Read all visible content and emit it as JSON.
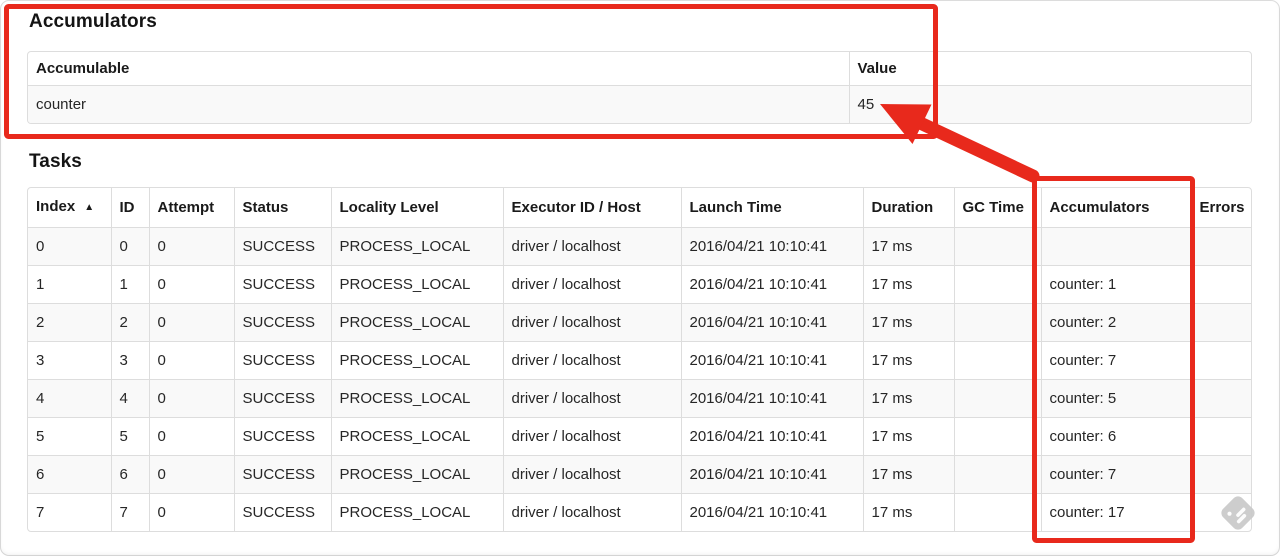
{
  "accumulators": {
    "title": "Accumulators",
    "table": {
      "headers": [
        "Accumulable",
        "Value"
      ],
      "rows": [
        [
          "counter",
          "45"
        ]
      ]
    }
  },
  "tasks": {
    "title": "Tasks",
    "table": {
      "headers": [
        "Index",
        "ID",
        "Attempt",
        "Status",
        "Locality Level",
        "Executor ID / Host",
        "Launch Time",
        "Duration",
        "GC Time",
        "Accumulators",
        "Errors"
      ],
      "sort_column": 0,
      "sort_indicator": "▲",
      "rows": [
        [
          "0",
          "0",
          "0",
          "SUCCESS",
          "PROCESS_LOCAL",
          "driver / localhost",
          "2016/04/21 10:10:41",
          "17 ms",
          "",
          "",
          ""
        ],
        [
          "1",
          "1",
          "0",
          "SUCCESS",
          "PROCESS_LOCAL",
          "driver / localhost",
          "2016/04/21 10:10:41",
          "17 ms",
          "",
          "counter: 1",
          ""
        ],
        [
          "2",
          "2",
          "0",
          "SUCCESS",
          "PROCESS_LOCAL",
          "driver / localhost",
          "2016/04/21 10:10:41",
          "17 ms",
          "",
          "counter: 2",
          ""
        ],
        [
          "3",
          "3",
          "0",
          "SUCCESS",
          "PROCESS_LOCAL",
          "driver / localhost",
          "2016/04/21 10:10:41",
          "17 ms",
          "",
          "counter: 7",
          ""
        ],
        [
          "4",
          "4",
          "0",
          "SUCCESS",
          "PROCESS_LOCAL",
          "driver / localhost",
          "2016/04/21 10:10:41",
          "17 ms",
          "",
          "counter: 5",
          ""
        ],
        [
          "5",
          "5",
          "0",
          "SUCCESS",
          "PROCESS_LOCAL",
          "driver / localhost",
          "2016/04/21 10:10:41",
          "17 ms",
          "",
          "counter: 6",
          ""
        ],
        [
          "6",
          "6",
          "0",
          "SUCCESS",
          "PROCESS_LOCAL",
          "driver / localhost",
          "2016/04/21 10:10:41",
          "17 ms",
          "",
          "counter: 7",
          ""
        ],
        [
          "7",
          "7",
          "0",
          "SUCCESS",
          "PROCESS_LOCAL",
          "driver / localhost",
          "2016/04/21 10:10:41",
          "17 ms",
          "",
          "counter: 17",
          ""
        ]
      ]
    }
  },
  "annotations": {
    "color": "#e8291c",
    "box1_target": "accumulators-section",
    "box2_target": "tasks-accumulators-column"
  },
  "watermark": {
    "name": "skitch-watermark",
    "color": "#c9c9c9"
  }
}
